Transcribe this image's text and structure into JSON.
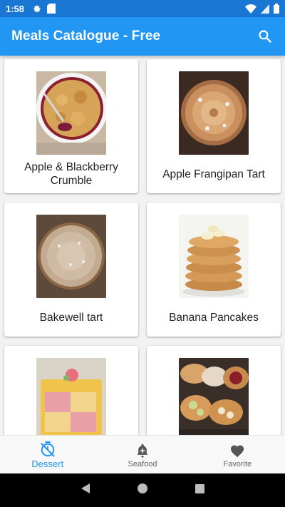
{
  "status_bar": {
    "time": "1:58"
  },
  "app_bar": {
    "title": "Meals Catalogue - Free"
  },
  "meals": [
    {
      "name": "Apple & Blackberry Crumble"
    },
    {
      "name": "Apple Frangipan Tart"
    },
    {
      "name": "Bakewell tart"
    },
    {
      "name": "Banana Pancakes"
    },
    {
      "name": ""
    },
    {
      "name": ""
    }
  ],
  "bottom_nav": {
    "items": [
      {
        "label": "Dessert",
        "icon": "timer-icon",
        "active": true
      },
      {
        "label": "Seafood",
        "icon": "bell-add-icon",
        "active": false
      },
      {
        "label": "Favorite",
        "icon": "heart-icon",
        "active": false
      }
    ]
  },
  "colors": {
    "primary": "#2196f3",
    "status_bar": "#1976d2",
    "active_nav": "#2196f3"
  }
}
